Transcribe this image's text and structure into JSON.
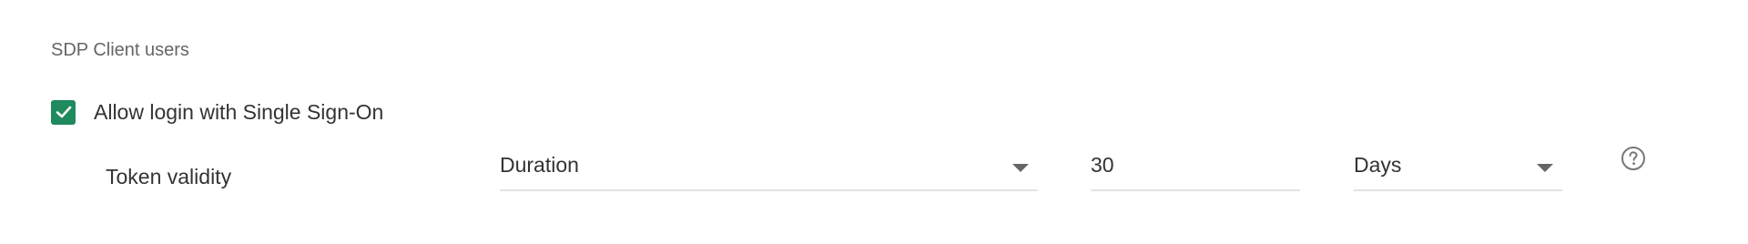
{
  "section": {
    "title": "SDP Client users"
  },
  "sso": {
    "checked": true,
    "label": "Allow login with Single Sign-On"
  },
  "token": {
    "label": "Token validity",
    "mode_value": "Duration",
    "amount_value": "30",
    "unit_value": "Days"
  },
  "icons": {
    "checkbox": "check-icon",
    "dropdown": "caret-down-icon",
    "help": "question-circle-icon"
  },
  "colors": {
    "checkbox_fill": "#1e8a5e",
    "text": "#333333",
    "muted_text": "#666666",
    "underline": "#e3e3e3"
  }
}
